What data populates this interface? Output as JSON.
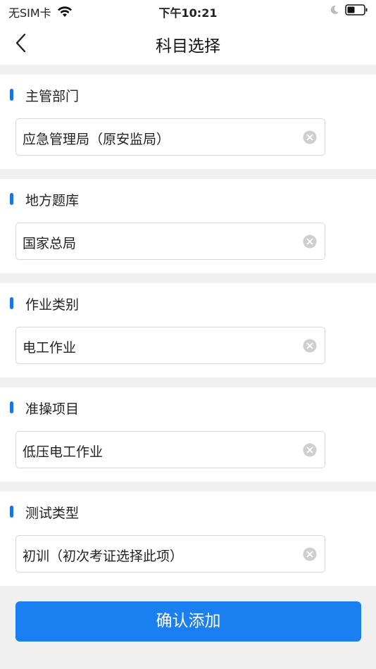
{
  "status_bar": {
    "carrier": "无SIM卡",
    "time": "下午10:21"
  },
  "nav": {
    "title": "科目选择"
  },
  "sections": [
    {
      "label": "主管部门",
      "value": "应急管理局（原安监局）"
    },
    {
      "label": "地方题库",
      "value": "国家总局"
    },
    {
      "label": "作业类别",
      "value": "电工作业"
    },
    {
      "label": "准操项目",
      "value": "低压电工作业"
    },
    {
      "label": "测试类型",
      "value": "初训（初次考证选择此项）"
    }
  ],
  "confirm_label": "确认添加",
  "colors": {
    "accent": "#1a7ff0",
    "marker": "#1a73e8",
    "background": "#f0f0f0"
  }
}
